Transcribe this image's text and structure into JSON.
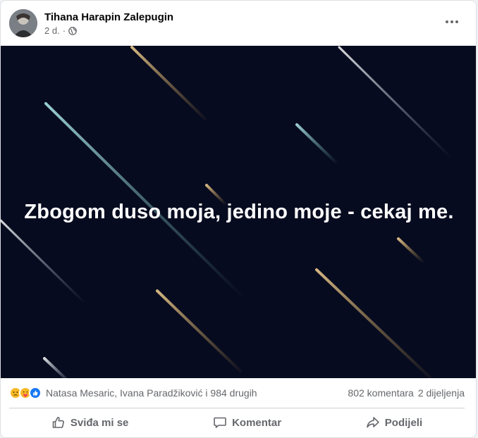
{
  "post": {
    "author_name": "Tihana Harapin Zalepugin",
    "timestamp": "2 d.",
    "separator": "·",
    "privacy_icon": "globe-icon",
    "more_icon": "more-horizontal-icon",
    "caption": "Zbogom duso moja, jedino moje - cekaj me."
  },
  "stats": {
    "reaction_icons": [
      "sad-reaction-icon",
      "care-reaction-icon",
      "like-reaction-icon"
    ],
    "reactors_text": "Natasa Mesaric, Ivana Paradžiković i 984 drugih",
    "comments_text": "802 komentara",
    "shares_text": "2 dijeljenja"
  },
  "actions": {
    "like_label": "Sviđa mi se",
    "comment_label": "Komentar",
    "share_label": "Podijeli"
  },
  "colors": {
    "background": "#070b1f",
    "muted_text": "#65676b",
    "like_blue": "#1877f2",
    "reaction_yellow": "#f7b928"
  }
}
